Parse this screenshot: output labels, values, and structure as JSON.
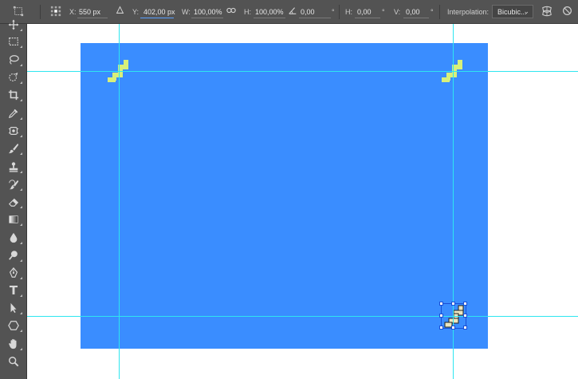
{
  "options_bar": {
    "x_label": "X:",
    "x_value": "550 px",
    "y_label": "Y:",
    "y_value": "402,00 px",
    "w_label": "W:",
    "w_value": "100,00%",
    "h_label": "H:",
    "h_value": "100,00%",
    "angle_value": "0,00",
    "angle_unit": "°",
    "hskew_label": "H:",
    "hskew_value": "0,00",
    "hskew_unit": "°",
    "vskew_label": "V:",
    "vskew_value": "0,00",
    "vskew_unit": "°",
    "interpolation_label": "Interpolation:",
    "interpolation_value": "Bicubic..."
  },
  "tools": [
    {
      "name": "move-tool",
      "icon": "move-icon"
    },
    {
      "name": "marquee-tool",
      "icon": "rect-marquee-icon"
    },
    {
      "name": "lasso-tool",
      "icon": "lasso-icon"
    },
    {
      "name": "quick-selection-tool",
      "icon": "quick-select-icon"
    },
    {
      "name": "crop-tool",
      "icon": "crop-icon"
    },
    {
      "name": "eyedropper-tool",
      "icon": "eyedropper-icon"
    },
    {
      "name": "healing-brush-tool",
      "icon": "bandage-icon"
    },
    {
      "name": "brush-tool",
      "icon": "brush-icon"
    },
    {
      "name": "clone-stamp-tool",
      "icon": "stamp-icon"
    },
    {
      "name": "history-brush-tool",
      "icon": "history-brush-icon"
    },
    {
      "name": "eraser-tool",
      "icon": "eraser-icon"
    },
    {
      "name": "gradient-tool",
      "icon": "gradient-icon"
    },
    {
      "name": "blur-tool",
      "icon": "drop-icon"
    },
    {
      "name": "dodge-tool",
      "icon": "dodge-icon"
    },
    {
      "name": "pen-tool",
      "icon": "pen-icon"
    },
    {
      "name": "type-tool",
      "icon": "type-icon",
      "glyph": "T"
    },
    {
      "name": "path-selection-tool",
      "icon": "arrow-icon"
    },
    {
      "name": "shape-tool",
      "icon": "hexagon-icon"
    },
    {
      "name": "hand-tool",
      "icon": "hand-icon"
    },
    {
      "name": "zoom-tool",
      "icon": "zoom-icon"
    }
  ],
  "colors": {
    "document_fill": "#3a8dff",
    "guide": "#2ee6f0",
    "stairs": "#d8f07a",
    "ui_panel": "#535353"
  }
}
